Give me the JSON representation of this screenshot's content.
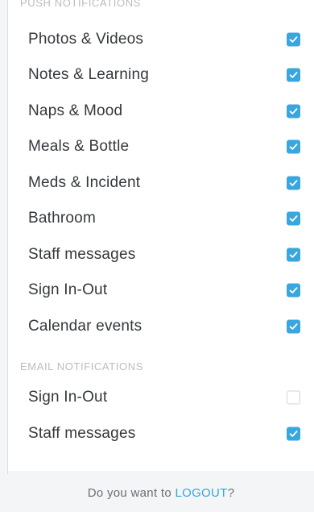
{
  "push_notifications": {
    "header": "PUSH NOTIFICATIONS",
    "items": [
      {
        "label": "Photos & Videos",
        "checked": true
      },
      {
        "label": "Notes & Learning",
        "checked": true
      },
      {
        "label": "Naps & Mood",
        "checked": true
      },
      {
        "label": "Meals & Bottle",
        "checked": true
      },
      {
        "label": "Meds & Incident",
        "checked": true
      },
      {
        "label": "Bathroom",
        "checked": true
      },
      {
        "label": "Staff messages",
        "checked": true
      },
      {
        "label": "Sign In-Out",
        "checked": true
      },
      {
        "label": "Calendar events",
        "checked": true
      }
    ]
  },
  "email_notifications": {
    "header": "EMAIL NOTIFICATIONS",
    "items": [
      {
        "label": "Sign In-Out",
        "checked": false
      },
      {
        "label": "Staff messages",
        "checked": true
      }
    ]
  },
  "footer": {
    "prompt": "Do you want to ",
    "logout_label": "LOGOUT",
    "suffix": "?"
  },
  "colors": {
    "accent": "#3aa6de",
    "link": "#35a6dc",
    "section_header": "#b9bdc1"
  },
  "icons": {
    "checked": "checkmark-icon"
  }
}
